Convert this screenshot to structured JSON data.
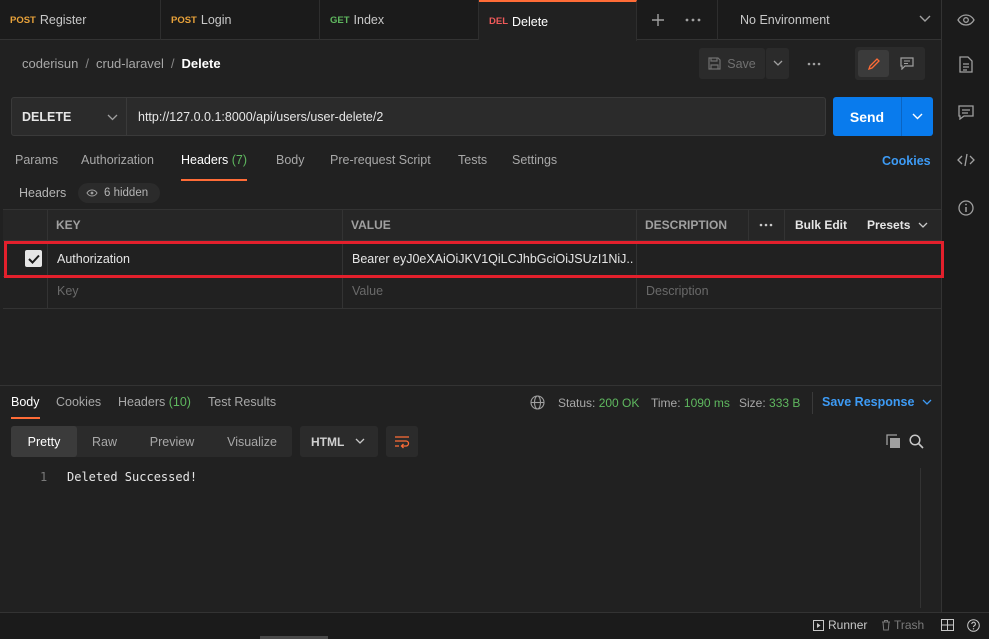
{
  "tabs": [
    {
      "method": "POST",
      "name": "Register"
    },
    {
      "method": "POST",
      "name": "Login"
    },
    {
      "method": "GET",
      "name": "Index"
    },
    {
      "method": "DEL",
      "name": "Delete"
    }
  ],
  "environment": "No Environment",
  "breadcrumb": {
    "workspace": "coderisun",
    "collection": "crud-laravel",
    "request": "Delete"
  },
  "save_label": "Save",
  "request": {
    "method": "DELETE",
    "url": "http://127.0.0.1:8000/api/users/user-delete/2",
    "send_label": "Send"
  },
  "request_tabs": [
    {
      "label": "Params"
    },
    {
      "label": "Authorization"
    },
    {
      "label": "Headers",
      "count": "(7)"
    },
    {
      "label": "Body"
    },
    {
      "label": "Pre-request Script"
    },
    {
      "label": "Tests"
    },
    {
      "label": "Settings"
    }
  ],
  "cookies_label": "Cookies",
  "headers_section": {
    "label": "Headers",
    "hidden": "6 hidden"
  },
  "table": {
    "columns": {
      "key": "KEY",
      "value": "VALUE",
      "description": "DESCRIPTION",
      "bulk_edit": "Bulk Edit",
      "presets": "Presets"
    },
    "rows": [
      {
        "key": "Authorization",
        "value": "Bearer eyJ0eXAiOiJKV1QiLCJhbGciOiJSUzI1NiJ...",
        "description": ""
      }
    ],
    "placeholders": {
      "key": "Key",
      "value": "Value",
      "description": "Description"
    }
  },
  "response_tabs": [
    {
      "label": "Body"
    },
    {
      "label": "Cookies"
    },
    {
      "label": "Headers",
      "count": "(10)"
    },
    {
      "label": "Test Results"
    }
  ],
  "status": {
    "status_label": "Status:",
    "status_value": "200 OK",
    "time_label": "Time:",
    "time_value": "1090 ms",
    "size_label": "Size:",
    "size_value": "333 B"
  },
  "save_response_label": "Save Response",
  "view_modes": [
    "Pretty",
    "Raw",
    "Preview",
    "Visualize"
  ],
  "format": "HTML",
  "response_body": [
    {
      "line": "1",
      "text": "Deleted Successed!"
    }
  ],
  "footer": {
    "runner": "Runner",
    "trash": "Trash"
  },
  "colors": {
    "accent": "#ff6c37",
    "send": "#097bed",
    "highlight": "#e3202c",
    "success": "#5fb85f"
  }
}
